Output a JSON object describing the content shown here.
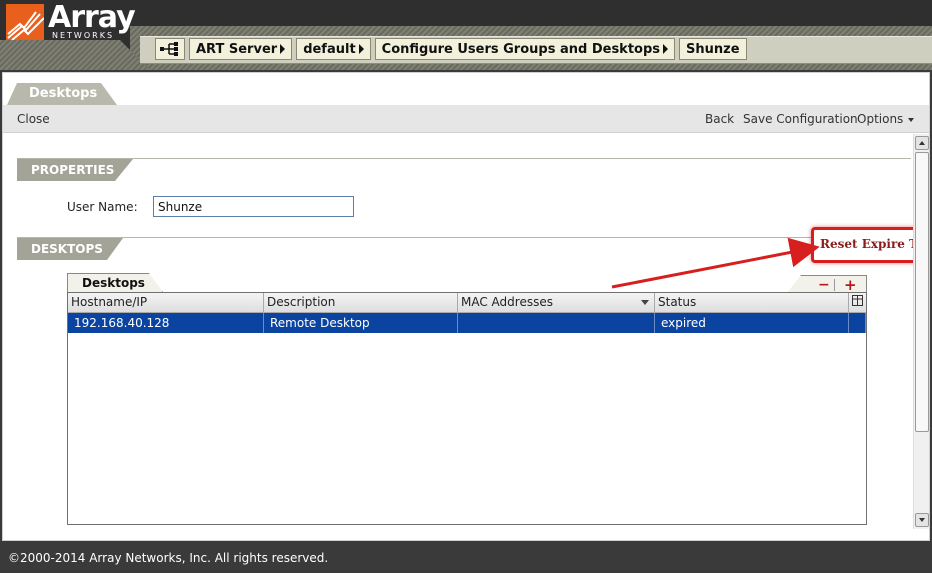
{
  "header": {
    "logo_text": "Array",
    "logo_sub": "NETWORKS",
    "breadcrumb": [
      {
        "label": "ART Server"
      },
      {
        "label": "default"
      },
      {
        "label": "Configure Users Groups and Desktops"
      },
      {
        "label": "Shunze"
      }
    ],
    "breadcrumb_icon": "network-tree-icon"
  },
  "page_tab": "Desktops",
  "toolbar": {
    "close_label": "Close",
    "back_label": "Back",
    "save_label": "Save Configuration",
    "options_label": "Options"
  },
  "properties": {
    "section_title": "PROPERTIES",
    "user_name_label": "User Name:",
    "user_name_value": "Shunze"
  },
  "desktops": {
    "section_title": "DESKTOPS",
    "reset_link": "Reset Expire Tim",
    "grid_tab": "Desktops",
    "remove_label": "−",
    "add_label": "+",
    "columns": [
      "Hostname/IP",
      "Description",
      "MAC Addresses",
      "Status"
    ],
    "rows": [
      {
        "hostname": "192.168.40.128",
        "description": "Remote Desktop",
        "mac": "",
        "status": "expired",
        "selected": true
      }
    ]
  },
  "footer": {
    "copyright": "©2000-2014 Array Networks, Inc. All rights reserved."
  },
  "colors": {
    "header_bg": "#2f2f2f",
    "logo_orange": "#e8601c",
    "selection_blue": "#0a44a0",
    "annotation_red": "#d71f1f",
    "reset_link_text": "#8b1c1c",
    "section_head": "#a3a397"
  }
}
